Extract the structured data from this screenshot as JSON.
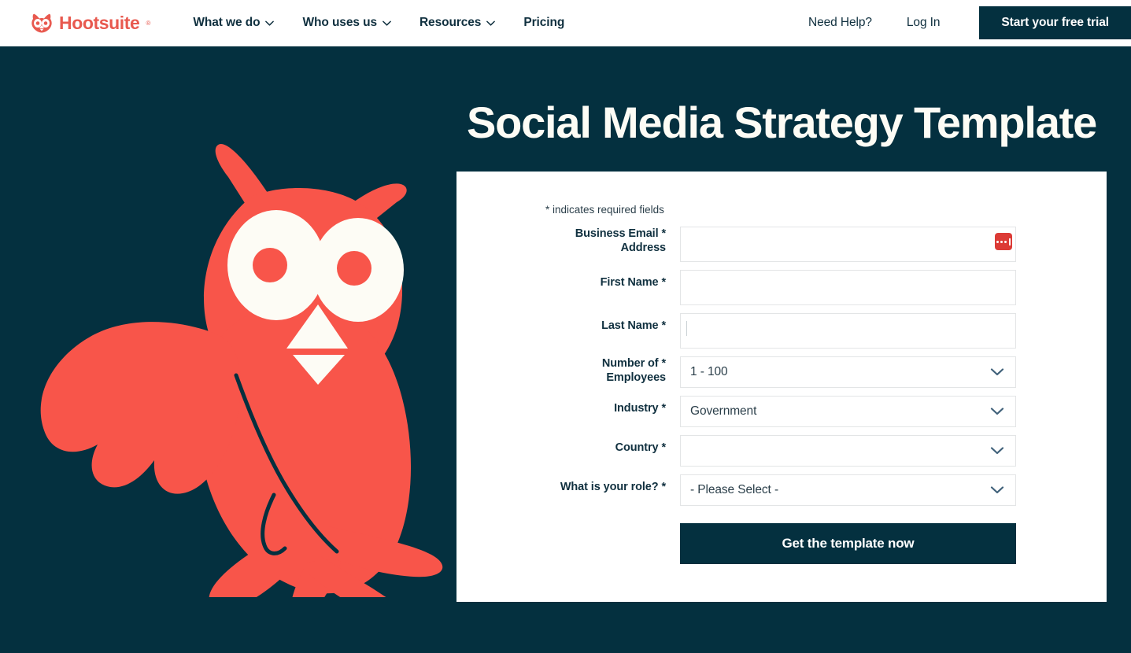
{
  "nav": {
    "brand_name": "Hootsuite",
    "brand_tm": "®",
    "links": [
      {
        "label": "What we do",
        "has_chevron": true
      },
      {
        "label": "Who uses us",
        "has_chevron": true
      },
      {
        "label": "Resources",
        "has_chevron": true
      },
      {
        "label": "Pricing",
        "has_chevron": false
      }
    ],
    "need_help": "Need Help?",
    "log_in": "Log In",
    "trial_button": "Start your free trial"
  },
  "hero": {
    "title": "Social Media Strategy Template",
    "background_color": "#04303f",
    "owl_color": "#f8554a",
    "owl_eye_color": "#fdfcf5"
  },
  "form": {
    "required_note": "* indicates required fields",
    "fields": [
      {
        "label": "Business Email * Address",
        "label_line1": "Business Email *",
        "label_line2": "Address",
        "type": "text",
        "value": "",
        "placeholder": "",
        "has_password_icon": true
      },
      {
        "label": "First Name *",
        "label_line1": "First Name *",
        "label_line2": "",
        "type": "text",
        "value": "",
        "placeholder": "",
        "has_password_icon": false
      },
      {
        "label": "Last Name *",
        "label_line1": "Last Name *",
        "label_line2": "",
        "type": "text",
        "value": "",
        "placeholder": "",
        "has_password_icon": false,
        "focused": true
      },
      {
        "label": "Number of * Employees",
        "label_line1": "Number of *",
        "label_line2": "Employees",
        "type": "select",
        "value": "1 - 100"
      },
      {
        "label": "Industry *",
        "label_line1": "Industry *",
        "label_line2": "",
        "type": "select",
        "value": "Government"
      },
      {
        "label": "Country *",
        "label_line1": "Country *",
        "label_line2": "",
        "type": "select",
        "value": ""
      },
      {
        "label": "What is your role? *",
        "label_line1": "What is your role? *",
        "label_line2": "",
        "type": "select",
        "value": "- Please Select -"
      }
    ],
    "submit_label": "Get the template now"
  },
  "colors": {
    "navy": "#04303f",
    "coral": "#f8554a",
    "brand_red": "#e8594f",
    "card_white": "#ffffff",
    "chevron_slate": "#40617a",
    "password_icon_red": "#dc3b36"
  }
}
